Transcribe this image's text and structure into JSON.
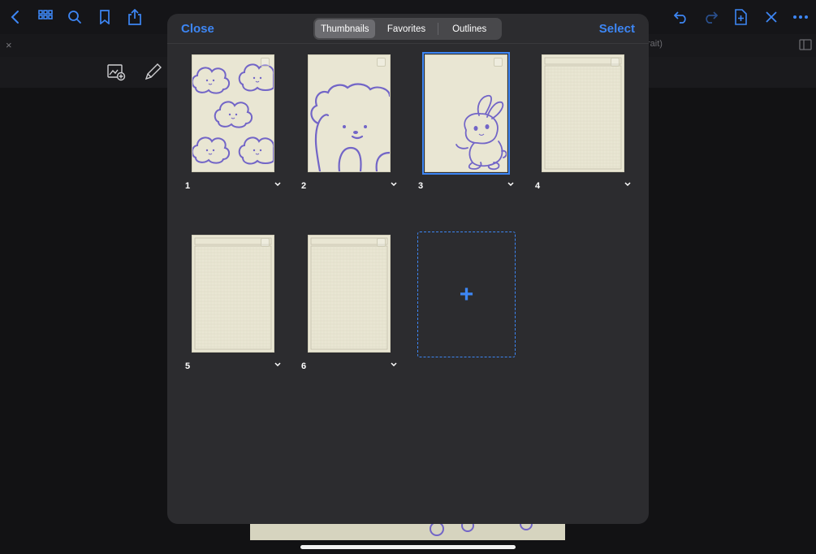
{
  "top_toolbar": {
    "icons": [
      "back-chevron-icon",
      "grid-view-icon",
      "search-icon",
      "bookmark-icon",
      "share-icon",
      "undo-icon",
      "redo-icon",
      "add-page-icon",
      "close-x-icon",
      "more-icon"
    ]
  },
  "tab_bar": {
    "close_symbol": "×",
    "truncated_label": "rait)"
  },
  "modal": {
    "close_label": "Close",
    "select_label": "Select",
    "tabs": [
      {
        "label": "Thumbnails",
        "active": true
      },
      {
        "label": "Favorites",
        "active": false
      },
      {
        "label": "Outlines",
        "active": false
      }
    ],
    "pages": [
      {
        "number": "1",
        "template": "clouds-pattern",
        "selected": false
      },
      {
        "number": "2",
        "template": "bear-outline",
        "selected": false
      },
      {
        "number": "3",
        "template": "bunny-outline",
        "selected": true
      },
      {
        "number": "4",
        "template": "grid-paper",
        "selected": false
      },
      {
        "number": "5",
        "template": "grid-paper",
        "selected": false
      },
      {
        "number": "6",
        "template": "grid-paper",
        "selected": false
      }
    ],
    "add_page_symbol": "+"
  },
  "colors": {
    "accent": "#3d86f4",
    "modal_bg": "#2c2c2f",
    "paper": "#e9e6d3",
    "doodle": "#7265c7"
  }
}
